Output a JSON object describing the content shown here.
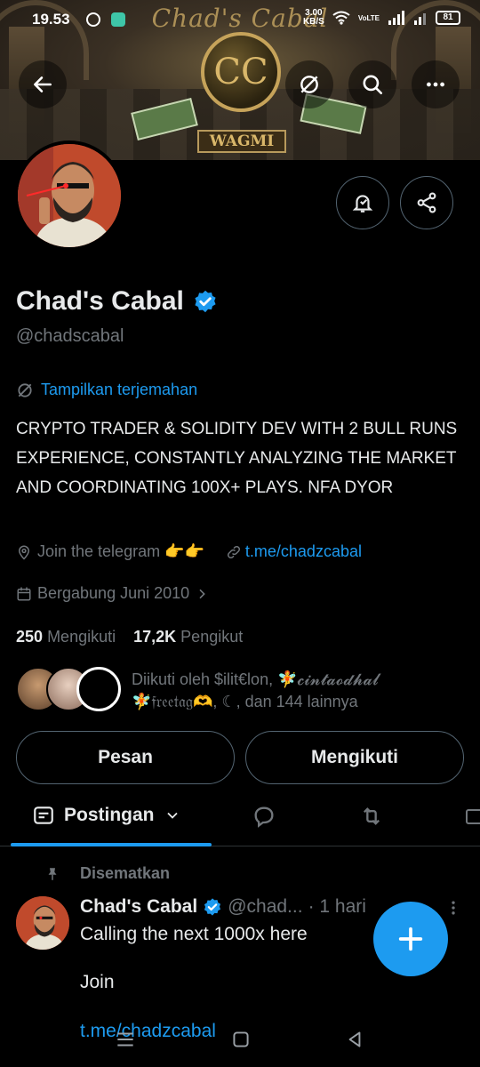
{
  "status_bar": {
    "time": "19.53",
    "speed": "3.00\nKB/S",
    "network": "VoLTE",
    "battery": "81"
  },
  "banner": {
    "brand_text": "Chad's Cabal",
    "emblem": "CC",
    "tagline": "WAGMI"
  },
  "profile": {
    "name": "Chad's Cabal",
    "handle": "@chadscabal",
    "translate_label": "Tampilkan terjemahan",
    "bio": "CRYPTO TRADER & SOLIDITY DEV WITH 2 BULL RUNS EXPERIENCE, CONSTANTLY ANALYZING THE MARKET AND COORDINATING 100X+ PLAYS. NFA DYOR",
    "location": "Join the telegram 👉👉",
    "link": "t.me/chadzcabal",
    "joined": "Bergabung Juni 2010",
    "following_count": "250",
    "following_label": "Mengikuti",
    "followers_count": "17,2K",
    "followers_label": "Pengikut",
    "followed_by_line1": "Diikuti oleh $ilit€lon, 🧚𝓬𝓲𝓷𝓽𝓪𝓸𝓭𝓱𝓪𝓵",
    "followed_by_line2": "🧚𝔣𝔯𝔢𝔢𝔱𝔞𝔤🫶, ☾, dan 144 lainnya"
  },
  "actions": {
    "message_label": "Pesan",
    "following_label": "Mengikuti"
  },
  "tabs": {
    "active_label": "Postingan"
  },
  "pinned_post": {
    "pinned_label": "Disematkan",
    "author_name": "Chad's Cabal",
    "author_handle": "@chad...",
    "time": "· 1 hari",
    "line1": "Calling the next 1000x here",
    "line2": "Join",
    "line3": "t.me/chadzcabal"
  },
  "colors": {
    "accent": "#1d9bf0",
    "background": "#000000",
    "text": "#e7e9ea",
    "muted": "#71767b",
    "border": "#536471"
  },
  "icons": [
    "back-arrow-icon",
    "translate-icon",
    "search-icon",
    "more-icon",
    "notification-bell-icon",
    "share-icon",
    "verified-badge-icon",
    "location-icon",
    "link-icon",
    "calendar-icon",
    "chevron-right-icon",
    "posts-tab-icon",
    "chevron-down-icon",
    "replies-tab-icon",
    "retweet-icon",
    "media-tab-icon",
    "pin-icon",
    "plus-icon"
  ]
}
